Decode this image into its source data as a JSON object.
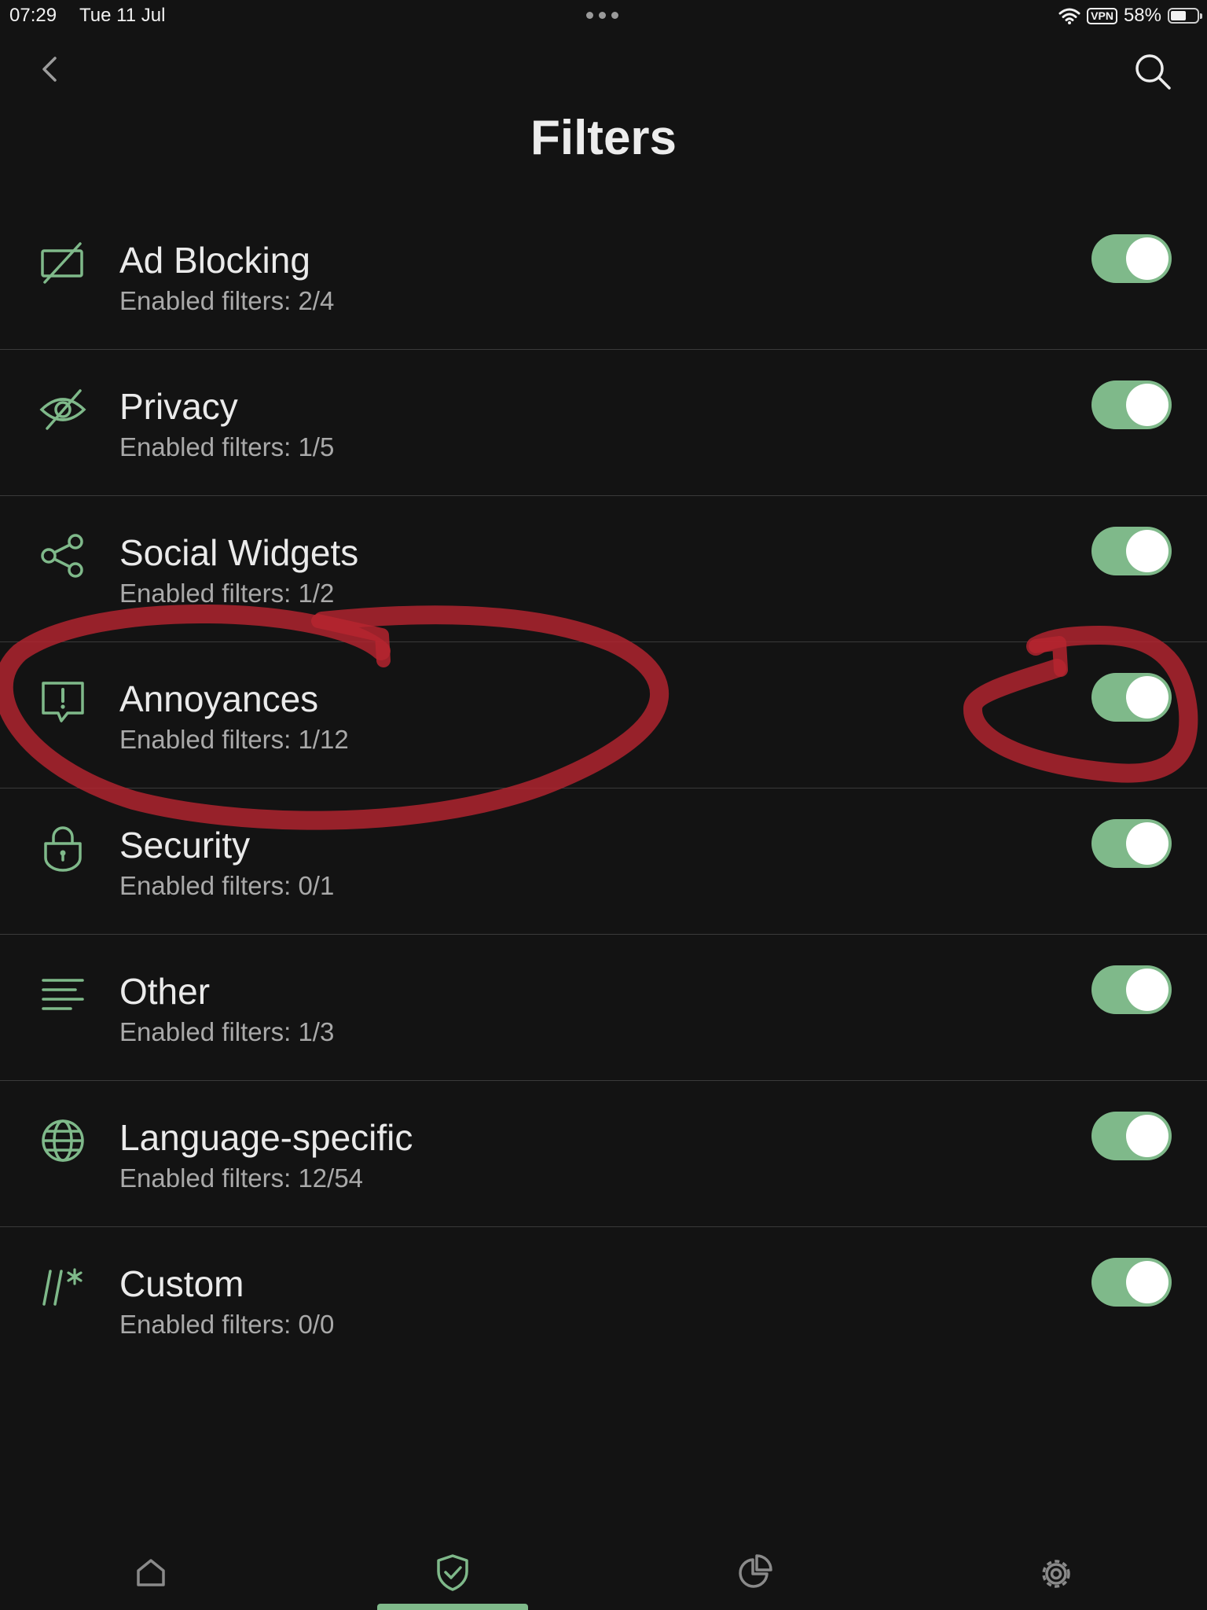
{
  "status_bar": {
    "time": "07:29",
    "date": "Tue 11 Jul",
    "vpn": "VPN",
    "battery_percent": "58%",
    "battery_level": 0.58
  },
  "header": {
    "title": "Filters"
  },
  "filters": [
    {
      "title": "Ad Blocking",
      "subtitle": "Enabled filters: 2/4",
      "enabled": true,
      "icon": "ad-blocking-icon"
    },
    {
      "title": "Privacy",
      "subtitle": "Enabled filters: 1/5",
      "enabled": true,
      "icon": "eye-slash-icon"
    },
    {
      "title": "Social Widgets",
      "subtitle": "Enabled filters: 1/2",
      "enabled": true,
      "icon": "share-icon"
    },
    {
      "title": "Annoyances",
      "subtitle": "Enabled filters: 1/12",
      "enabled": true,
      "icon": "alert-message-icon"
    },
    {
      "title": "Security",
      "subtitle": "Enabled filters: 0/1",
      "enabled": true,
      "icon": "lock-icon"
    },
    {
      "title": "Other",
      "subtitle": "Enabled filters: 1/3",
      "enabled": true,
      "icon": "lines-icon"
    },
    {
      "title": "Language-specific",
      "subtitle": "Enabled filters: 12/54",
      "enabled": true,
      "icon": "globe-icon"
    },
    {
      "title": "Custom",
      "subtitle": "Enabled filters: 0/0",
      "enabled": true,
      "icon": "custom-rule-icon"
    }
  ],
  "tabs": [
    {
      "icon": "home-icon",
      "active": false
    },
    {
      "icon": "shield-check-icon",
      "active": true
    },
    {
      "icon": "pie-chart-icon",
      "active": false
    },
    {
      "icon": "gear-icon",
      "active": false
    }
  ],
  "colors": {
    "background": "#131313",
    "accent": "#7fb98a",
    "annotation": "#b5242f"
  }
}
